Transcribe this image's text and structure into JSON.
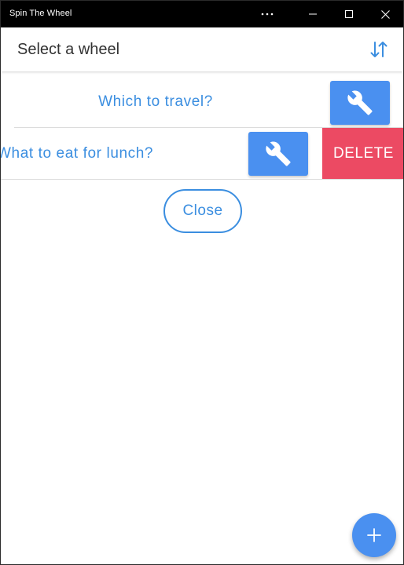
{
  "window": {
    "title": "Spin The Wheel",
    "controls": [
      "more-icon",
      "minimize-icon",
      "maximize-icon",
      "close-icon"
    ]
  },
  "header": {
    "title": "Select a wheel",
    "sort_icon": "sort-arrows-icon"
  },
  "wheels": [
    {
      "label": "Which to travel?",
      "edit_icon": "wrench-icon"
    },
    {
      "label": "What to eat for lunch?",
      "edit_icon": "wrench-icon",
      "delete_label": "DELETE"
    }
  ],
  "actions": {
    "close_label": "Close",
    "add_icon": "plus-icon"
  },
  "colors": {
    "accent": "#3b8ee0",
    "button": "#4a90f0",
    "danger": "#ec4a63",
    "titlebar": "#000000"
  }
}
